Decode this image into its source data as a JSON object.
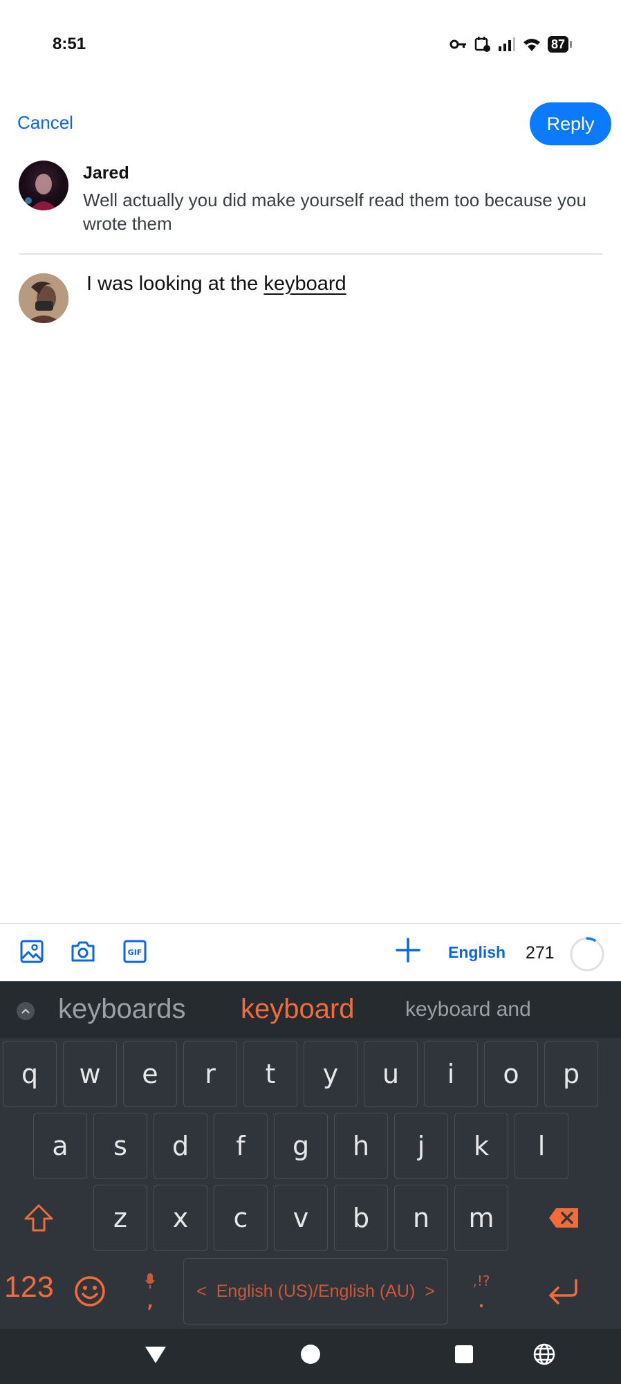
{
  "status_bar": {
    "time": "8:51",
    "battery": "87"
  },
  "header": {
    "cancel_label": "Cancel",
    "reply_label": "Reply"
  },
  "quoted_post": {
    "author": "Jared",
    "text": "Well actually you did make yourself read them too because you wrote them"
  },
  "compose": {
    "text_before": "I was looking at the ",
    "text_underlined": "keyboard"
  },
  "toolbar": {
    "language": "English",
    "char_count": "271",
    "icons": [
      "image-icon",
      "camera-icon",
      "gif-icon",
      "plus-icon"
    ]
  },
  "keyboard": {
    "suggestions": [
      "keyboards",
      "keyboard",
      "keyboard and"
    ],
    "row1": [
      "q",
      "w",
      "e",
      "r",
      "t",
      "y",
      "u",
      "i",
      "o",
      "p"
    ],
    "row2": [
      "a",
      "s",
      "d",
      "f",
      "g",
      "h",
      "j",
      "k",
      "l"
    ],
    "row3": [
      "z",
      "x",
      "c",
      "v",
      "b",
      "n",
      "m"
    ],
    "num_label": "123",
    "space_label": "English (US)/English (AU)",
    "comma": ",",
    "period": ".",
    "punct_hint": ",!?",
    "accent_color": "#f26b3a"
  },
  "colors": {
    "brand_blue": "#0a7aff",
    "link_blue": "#0a66e6",
    "keyboard_bg": "#2f353b"
  }
}
